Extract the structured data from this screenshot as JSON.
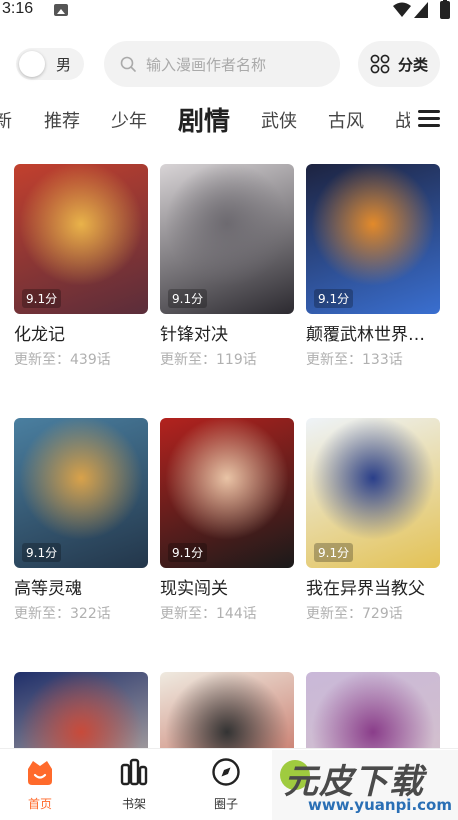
{
  "status_bar": {
    "time": "3:16"
  },
  "header": {
    "gender_label": "男",
    "search_placeholder": "输入漫画作者名称",
    "category_label": "分类"
  },
  "tabs": [
    {
      "label": "新"
    },
    {
      "label": "推荐"
    },
    {
      "label": "少年"
    },
    {
      "label": "剧情",
      "active": true
    },
    {
      "label": "武侠"
    },
    {
      "label": "古风"
    },
    {
      "label": "战"
    }
  ],
  "comics": [
    {
      "title": "化龙记",
      "update": "更新至：439话",
      "score": "9.1分",
      "colors": [
        "#c2402e",
        "#e9b34a",
        "#5a2d3a"
      ]
    },
    {
      "title": "针锋对决",
      "update": "更新至：119话",
      "score": "9.1分",
      "colors": [
        "#d8d4d6",
        "#6d6a70",
        "#2c2a30"
      ]
    },
    {
      "title": "颠覆武林世界…",
      "update": "更新至：133话",
      "score": "9.1分",
      "colors": [
        "#1d2340",
        "#e38a2a",
        "#3a6fd0"
      ]
    },
    {
      "title": "高等灵魂",
      "update": "更新至：322话",
      "score": "9.1分",
      "colors": [
        "#4a7fa0",
        "#d9a24a",
        "#23364a"
      ]
    },
    {
      "title": "现实闯关",
      "update": "更新至：144话",
      "score": "9.1分",
      "colors": [
        "#b3221e",
        "#e9c4a6",
        "#1a1a1a"
      ]
    },
    {
      "title": "我在异界当教父",
      "update": "更新至：729话",
      "score": "9.1分",
      "colors": [
        "#eef3f8",
        "#2a3f8a",
        "#e3c255"
      ]
    },
    {
      "title": "",
      "update": "",
      "score": "",
      "colors": [
        "#1f2f6a",
        "#c84a3a",
        "#e6d4b8"
      ]
    },
    {
      "title": "",
      "update": "",
      "score": "",
      "colors": [
        "#efeae0",
        "#333333",
        "#b84a3a"
      ]
    },
    {
      "title": "",
      "update": "",
      "score": "",
      "colors": [
        "#c9b8d8",
        "#8a3d8a",
        "#d8c4c8"
      ]
    }
  ],
  "bottom_nav": [
    {
      "label": "首页",
      "icon": "home-icon",
      "active": true
    },
    {
      "label": "书架",
      "icon": "bookshelf-icon"
    },
    {
      "label": "圈子",
      "icon": "compass-icon"
    },
    {
      "label": "",
      "icon": "discover-icon"
    },
    {
      "label": "",
      "icon": "profile-icon"
    }
  ],
  "watermark": {
    "text": "元皮下载",
    "url": "www.yuanpi.com"
  },
  "colors": {
    "accent": "#ff6a2b",
    "muted": "#b0b0b0",
    "pill_bg": "#f2f2f2"
  }
}
